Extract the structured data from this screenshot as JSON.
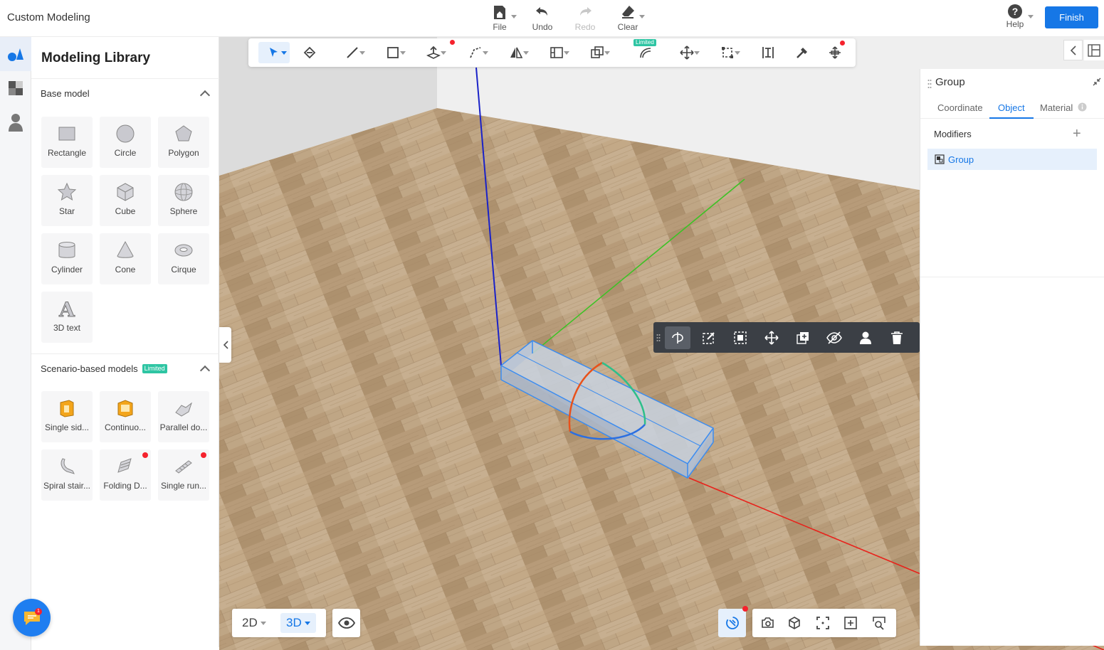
{
  "header": {
    "app_title": "Custom Modeling",
    "actions": [
      {
        "label": "File",
        "icon": "file-home-icon"
      },
      {
        "label": "Undo",
        "icon": "undo-icon"
      },
      {
        "label": "Redo",
        "icon": "redo-icon"
      },
      {
        "label": "Clear",
        "icon": "eraser-icon"
      }
    ],
    "help_label": "Help",
    "finish_label": "Finish"
  },
  "library": {
    "title": "Modeling Library",
    "base_section": "Base model",
    "base_items": [
      "Rectangle",
      "Circle",
      "Polygon",
      "Star",
      "Cube",
      "Sphere",
      "Cylinder",
      "Cone",
      "Cirque",
      "3D text"
    ],
    "scenario_section": "Scenario-based models",
    "scenario_badge": "Limited",
    "scenario_items": [
      "Single sid...",
      "Continuo...",
      "Parallel do...",
      "Spiral stair...",
      "Folding D...",
      "Single run..."
    ]
  },
  "toolbar": {
    "limited_badge": "Limited"
  },
  "properties": {
    "title": "Group",
    "tabs": [
      "Coordinate",
      "Object",
      "Material"
    ],
    "active_tab": "Object",
    "modifiers_label": "Modifiers",
    "modifier_items": [
      "Group"
    ]
  },
  "viewmode": {
    "two_d": "2D",
    "three_d": "3D",
    "active": "3D"
  },
  "colors": {
    "accent": "#1677e6",
    "limited_badge": "#2ec5a3",
    "alert_dot": "#f5222d",
    "context_bar": "#3b3f45",
    "axis_x": "#e8221b",
    "axis_y": "#3ec226",
    "axis_z": "#1a22c8"
  }
}
